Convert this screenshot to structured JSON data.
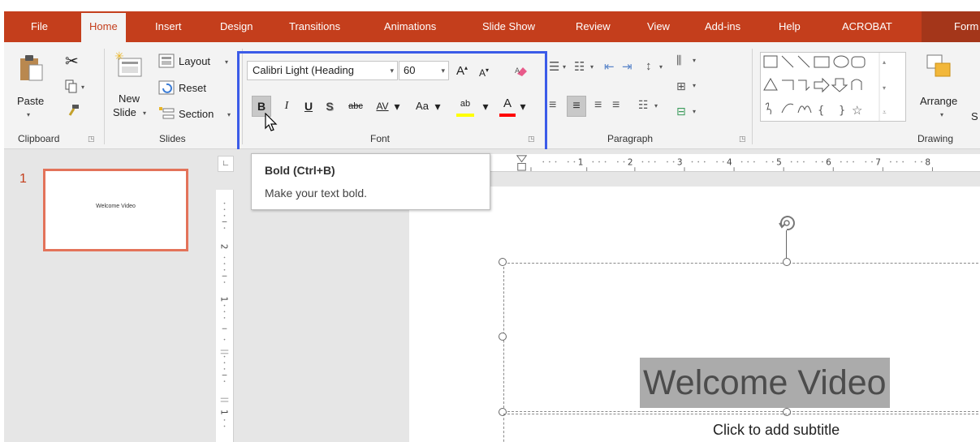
{
  "tabs": [
    {
      "label": "File"
    },
    {
      "label": "Home"
    },
    {
      "label": "Insert"
    },
    {
      "label": "Design"
    },
    {
      "label": "Transitions"
    },
    {
      "label": "Animations"
    },
    {
      "label": "Slide Show"
    },
    {
      "label": "Review"
    },
    {
      "label": "View"
    },
    {
      "label": "Add-ins"
    },
    {
      "label": "Help"
    },
    {
      "label": "ACROBAT"
    },
    {
      "label": "Form"
    }
  ],
  "ribbon": {
    "clipboard": {
      "label": "Clipboard",
      "paste": "Paste"
    },
    "slides": {
      "label": "Slides",
      "new_slide_1": "New",
      "new_slide_2": "Slide",
      "layout": "Layout",
      "reset": "Reset",
      "section": "Section"
    },
    "font": {
      "label": "Font",
      "font_name": "Calibri Light (Heading",
      "font_size": "60",
      "bold": "B",
      "italic": "I",
      "underline": "U",
      "shadow": "S",
      "strike": "abc",
      "spacing": "AV",
      "case": "Aa",
      "highlight_glyph": "ab",
      "color_glyph": "A"
    },
    "paragraph": {
      "label": "Paragraph"
    },
    "drawing": {
      "label": "Drawing",
      "arrange": "Arrange",
      "cut_off": "S"
    }
  },
  "tooltip": {
    "title": "Bold (Ctrl+B)",
    "description": "Make your text bold."
  },
  "thumbnails": [
    {
      "number": "1",
      "text": "Welcome Video"
    }
  ],
  "slide": {
    "title": "Welcome Video",
    "subtitle": "Click to add subtitle"
  },
  "ruler": {
    "h_ticks": [
      "1",
      "2",
      "3",
      "4",
      "5",
      "6",
      "7",
      "8"
    ],
    "v_ticks": [
      "2",
      "1",
      "1"
    ]
  },
  "colors": {
    "accent": "#c43e1c",
    "highlight_box": "#3b5be8",
    "thumbnail_border": "#e3735a",
    "text_highlight": "#ffff00",
    "font_color": "#ff0000"
  }
}
